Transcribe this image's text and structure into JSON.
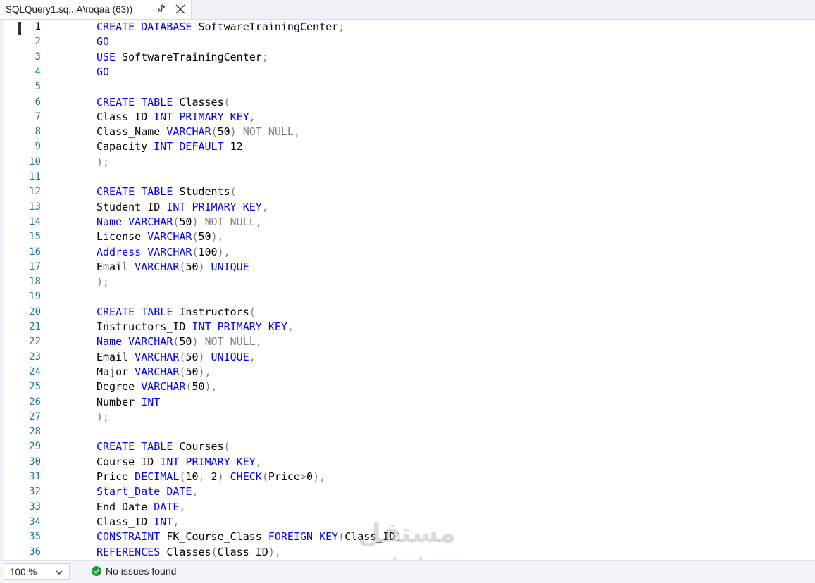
{
  "tab": {
    "title": "SQLQuery1.sq...A\\roqaa (63))"
  },
  "editor": {
    "current_line": 1,
    "lines": [
      {
        "n": "1",
        "t": [
          [
            "kw",
            "CREATE DATABASE"
          ],
          [
            "",
            "SoftwareTrainingCenter"
          ],
          [
            "gr",
            ";"
          ]
        ]
      },
      {
        "n": "2",
        "t": [
          [
            "kw",
            "GO"
          ]
        ]
      },
      {
        "n": "3",
        "t": [
          [
            "kw",
            "USE"
          ],
          [
            "",
            "SoftwareTrainingCenter"
          ],
          [
            "gr",
            ";"
          ]
        ]
      },
      {
        "n": "4",
        "t": [
          [
            "kw",
            "GO"
          ]
        ]
      },
      {
        "n": "5",
        "t": []
      },
      {
        "n": "6",
        "t": [
          [
            "kw",
            "CREATE TABLE"
          ],
          [
            "",
            "Classes"
          ],
          [
            "gr",
            "("
          ]
        ]
      },
      {
        "n": "7",
        "t": [
          [
            "",
            "Class_ID"
          ],
          [
            "kw",
            "INT PRIMARY KEY"
          ],
          [
            "gr",
            ","
          ]
        ]
      },
      {
        "n": "8",
        "t": [
          [
            "",
            "Class_Name"
          ],
          [
            "kw",
            "VARCHAR"
          ],
          [
            "gr",
            "("
          ],
          [
            "num",
            "50"
          ],
          [
            "gr",
            ") NOT NULL,"
          ]
        ]
      },
      {
        "n": "9",
        "t": [
          [
            "",
            "Capacity"
          ],
          [
            "kw",
            "INT DEFAULT"
          ],
          [
            "num",
            "12"
          ]
        ]
      },
      {
        "n": "10",
        "t": [
          [
            "gr",
            ");"
          ]
        ]
      },
      {
        "n": "11",
        "t": []
      },
      {
        "n": "12",
        "t": [
          [
            "kw",
            "CREATE TABLE"
          ],
          [
            "",
            "Students"
          ],
          [
            "gr",
            "("
          ]
        ]
      },
      {
        "n": "13",
        "t": [
          [
            "",
            "Student_ID"
          ],
          [
            "kw",
            "INT PRIMARY KEY"
          ],
          [
            "gr",
            ","
          ]
        ]
      },
      {
        "n": "14",
        "t": [
          [
            "kw",
            "Name VARCHAR"
          ],
          [
            "gr",
            "("
          ],
          [
            "num",
            "50"
          ],
          [
            "gr",
            ") NOT NULL,"
          ]
        ]
      },
      {
        "n": "15",
        "t": [
          [
            "",
            "License"
          ],
          [
            "kw",
            "VARCHAR"
          ],
          [
            "gr",
            "("
          ],
          [
            "num",
            "50"
          ],
          [
            "gr",
            "),"
          ]
        ]
      },
      {
        "n": "16",
        "t": [
          [
            "kw",
            "Address VARCHAR"
          ],
          [
            "gr",
            "("
          ],
          [
            "num",
            "100"
          ],
          [
            "gr",
            "),"
          ]
        ]
      },
      {
        "n": "17",
        "t": [
          [
            "",
            "Email"
          ],
          [
            "kw",
            "VARCHAR"
          ],
          [
            "gr",
            "("
          ],
          [
            "num",
            "50"
          ],
          [
            "gr",
            ")"
          ],
          [
            "kw",
            "UNIQUE"
          ]
        ]
      },
      {
        "n": "18",
        "t": [
          [
            "gr",
            ");"
          ]
        ]
      },
      {
        "n": "19",
        "t": []
      },
      {
        "n": "20",
        "t": [
          [
            "kw",
            "CREATE TABLE"
          ],
          [
            "",
            "Instructors"
          ],
          [
            "gr",
            "("
          ]
        ]
      },
      {
        "n": "21",
        "t": [
          [
            "",
            "Instructors_ID"
          ],
          [
            "kw",
            "INT PRIMARY KEY"
          ],
          [
            "gr",
            ","
          ]
        ]
      },
      {
        "n": "22",
        "t": [
          [
            "kw",
            "Name VARCHAR"
          ],
          [
            "gr",
            "("
          ],
          [
            "num",
            "50"
          ],
          [
            "gr",
            ") NOT NULL,"
          ]
        ]
      },
      {
        "n": "23",
        "t": [
          [
            "",
            "Email"
          ],
          [
            "kw",
            "VARCHAR"
          ],
          [
            "gr",
            "("
          ],
          [
            "num",
            "50"
          ],
          [
            "gr",
            ")"
          ],
          [
            "kw",
            "UNIQUE"
          ],
          [
            "gr",
            ","
          ]
        ]
      },
      {
        "n": "24",
        "t": [
          [
            "",
            "Major"
          ],
          [
            "kw",
            "VARCHAR"
          ],
          [
            "gr",
            "("
          ],
          [
            "num",
            "50"
          ],
          [
            "gr",
            "),"
          ]
        ]
      },
      {
        "n": "25",
        "t": [
          [
            "",
            "Degree"
          ],
          [
            "kw",
            "VARCHAR"
          ],
          [
            "gr",
            "("
          ],
          [
            "num",
            "50"
          ],
          [
            "gr",
            "),"
          ]
        ]
      },
      {
        "n": "26",
        "t": [
          [
            "",
            "Number"
          ],
          [
            "kw",
            "INT"
          ]
        ]
      },
      {
        "n": "27",
        "t": [
          [
            "gr",
            ");"
          ]
        ]
      },
      {
        "n": "28",
        "t": []
      },
      {
        "n": "29",
        "t": [
          [
            "kw",
            "CREATE TABLE"
          ],
          [
            "",
            "Courses"
          ],
          [
            "gr",
            "("
          ]
        ]
      },
      {
        "n": "30",
        "t": [
          [
            "",
            "Course_ID"
          ],
          [
            "kw",
            "INT PRIMARY KEY"
          ],
          [
            "gr",
            ","
          ]
        ]
      },
      {
        "n": "31",
        "t": [
          [
            "",
            "Price"
          ],
          [
            "kw",
            "DECIMAL"
          ],
          [
            "gr",
            "("
          ],
          [
            "num",
            "10"
          ],
          [
            "gr",
            ","
          ],
          [
            "num",
            "2"
          ],
          [
            "gr",
            ")"
          ],
          [
            "kw",
            "CHECK"
          ],
          [
            "gr",
            "("
          ],
          [
            "",
            "Price"
          ],
          [
            "gr",
            ">"
          ],
          [
            "num",
            "0"
          ],
          [
            "gr",
            "),"
          ]
        ]
      },
      {
        "n": "32",
        "t": [
          [
            "kw",
            "Start_Date DATE"
          ],
          [
            "gr",
            ","
          ]
        ]
      },
      {
        "n": "33",
        "t": [
          [
            "",
            "End_Date"
          ],
          [
            "kw",
            "DATE"
          ],
          [
            "gr",
            ","
          ]
        ]
      },
      {
        "n": "34",
        "t": [
          [
            "",
            "Class_ID"
          ],
          [
            "kw",
            "INT"
          ],
          [
            "gr",
            ","
          ]
        ]
      },
      {
        "n": "35",
        "t": [
          [
            "kw",
            "CONSTRAINT"
          ],
          [
            "",
            "FK_Course_Class"
          ],
          [
            "kw",
            "FOREIGN KEY"
          ],
          [
            "gr",
            "("
          ],
          [
            "",
            "Class_ID"
          ],
          [
            "gr",
            ")"
          ]
        ]
      },
      {
        "n": "36",
        "t": [
          [
            "kw",
            "REFERENCES"
          ],
          [
            "",
            "Classes"
          ],
          [
            "gr",
            "("
          ],
          [
            "",
            "Class_ID"
          ],
          [
            "gr",
            "),"
          ]
        ]
      }
    ]
  },
  "watermark": {
    "logo": "مستقل",
    "text": "mostaql.com"
  },
  "status": {
    "zoom": "100 %",
    "issues": "No issues found"
  },
  "colors": {
    "keyword": "#0000ff",
    "operator": "#808080",
    "line_number": "#237893",
    "ok": "#1e9e3a"
  }
}
